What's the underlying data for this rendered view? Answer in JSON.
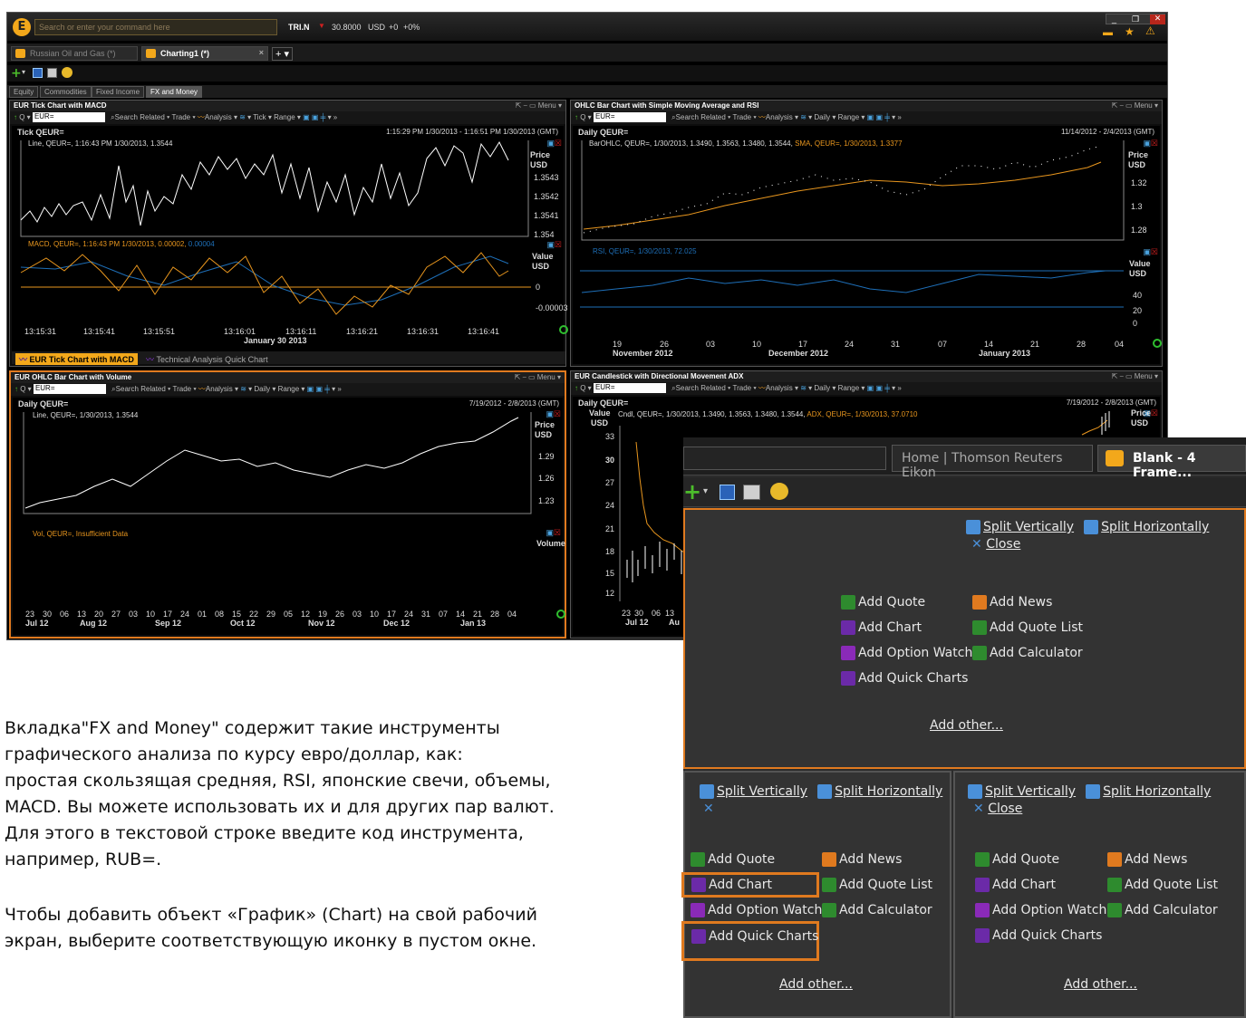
{
  "app": {
    "search_placeholder": "Search or enter your command here",
    "ticker": "TRI.N",
    "price": "30.8000",
    "currency": "USD",
    "change": "+0",
    "change_pct": "+0%"
  },
  "workspace_tabs": [
    {
      "label": "Russian Oil and Gas (*)"
    },
    {
      "label": "Charting1 (*)"
    }
  ],
  "sub_tabs": [
    "Equity",
    "Commodities",
    "Fixed Income",
    "FX and Money"
  ],
  "panels": {
    "tl": {
      "title": "EUR Tick Chart with MACD",
      "ric": "EUR=",
      "chart_label": "Tick QEUR=",
      "range": "1:15:29 PM 1/30/2013 - 1:16:51 PM 1/30/2013 (GMT)",
      "legend1": "Line, QEUR=, 1:16:43 PM 1/30/2013, 1.3544",
      "legend2": "MACD, QEUR=, 1:16:43 PM 1/30/2013, 0.00002,",
      "legend2b": "0.00004",
      "axis_price": "Price",
      "axis_usd": "USD",
      "ticks_price": [
        "1.3543",
        "1.3542",
        "1.3541",
        "1.354"
      ],
      "axis_value": "Value",
      "ticks_value": [
        "0",
        "-0.00003"
      ],
      "times": [
        "13:15:31",
        "13:15:41",
        "13:15:51",
        "13:16:01",
        "13:16:11",
        "13:16:21",
        "13:16:31",
        "13:16:41"
      ],
      "date": "January 30 2013",
      "tab1": "EUR Tick Chart with MACD",
      "tab2": "Technical Analysis Quick Chart"
    },
    "tr": {
      "title": "OHLC Bar Chart with Simple Moving Average and RSI",
      "ric": "EUR=",
      "chart_label": "Daily QEUR=",
      "range": "11/14/2012 - 2/4/2013 (GMT)",
      "legend1": "BarOHLC, QEUR=, 1/30/2013, 1.3490, 1.3563, 1.3480, 1.3544,",
      "legend1b": "SMA, QEUR=, 1/30/2013, 1.3377",
      "legend2": "RSI, QEUR=, 1/30/2013, 72.025",
      "ticks_price": [
        "1.32",
        "1.3",
        "1.28"
      ],
      "ticks_value": [
        "40",
        "20",
        "0"
      ],
      "days": [
        "19",
        "26",
        "03",
        "10",
        "17",
        "24",
        "31",
        "07",
        "14",
        "21",
        "28",
        "04"
      ],
      "months": [
        "November 2012",
        "December 2012",
        "January 2013"
      ]
    },
    "bl": {
      "title": "EUR OHLC Bar Chart with Volume",
      "ric": "EUR=",
      "chart_label": "Daily QEUR=",
      "range": "7/19/2012 - 2/8/2013 (GMT)",
      "legend1": "Line, QEUR=, 1/30/2013, 1.3544",
      "legend2": "Vol, QEUR=, Insufficient Data",
      "ticks_price": [
        "1.29",
        "1.26",
        "1.23"
      ],
      "axis_volume": "Volume",
      "days": [
        "23",
        "30",
        "06",
        "13",
        "20",
        "27",
        "03",
        "10",
        "17",
        "24",
        "01",
        "08",
        "15",
        "22",
        "29",
        "05",
        "12",
        "19",
        "26",
        "03",
        "10",
        "17",
        "24",
        "31",
        "07",
        "14",
        "21",
        "28",
        "04"
      ],
      "months": [
        "Jul 12",
        "Aug 12",
        "Sep 12",
        "Oct 12",
        "Nov 12",
        "Dec 12",
        "Jan 13"
      ]
    },
    "br": {
      "title": "EUR Candlestick with Directional Movement ADX",
      "ric": "EUR=",
      "chart_label": "Daily QEUR=",
      "range": "7/19/2012 - 2/8/2013 (GMT)",
      "legend1": "Cndl, QEUR=, 1/30/2013, 1.3490, 1.3563, 1.3480, 1.3544,",
      "legend1b": "ADX, QEUR=, 1/30/2013, 37.0710",
      "ticks": [
        "33",
        "30",
        "27",
        "24",
        "21",
        "18",
        "15",
        "12"
      ],
      "days": [
        "23",
        "30",
        "06",
        "13"
      ],
      "months": [
        "Jul 12",
        "Au"
      ]
    }
  },
  "toolbar": {
    "search": "Search",
    "related": "Related",
    "trade": "Trade",
    "analysis": "Analysis",
    "tick": "Tick",
    "daily": "Daily",
    "range": "Range",
    "menu": "Menu"
  },
  "overlay": {
    "home_tab": "Home | Thomson Reuters Eikon",
    "blank_tab": "Blank - 4 Frame...",
    "split_v": "Split Vertically",
    "split_h": "Split Horizontally",
    "close": "Close",
    "add_quote": "Add Quote",
    "add_news": "Add News",
    "add_chart": "Add Chart",
    "add_quote_list": "Add Quote List",
    "add_option_watch": "Add Option Watch",
    "add_calculator": "Add Calculator",
    "add_quick_charts": "Add Quick Charts",
    "add_other": "Add other..."
  },
  "text": {
    "p1": [
      "Вкладка\"FX and Money\" содержит такие  инструменты",
      "графического анализа  по курсу евро/доллар,  как:",
      "простая скользящая средняя, RSI, японские свечи, объемы,",
      "MACD. Вы можете использовать их и для других пар валют.",
      "Для этого в текстовой строке введите код инструмента,",
      "например, RUB=."
    ],
    "p2": [
      "Чтобы добавить объект «График» (Chart) на свой рабочий",
      "экран, выберите соответствующую иконку в пустом окне."
    ]
  },
  "colors": {
    "accent": "#e07a1f",
    "brand": "#f3a81b",
    "line": "#ffffff",
    "indicator": "#e8961e",
    "indicator2": "#1e6fb8"
  }
}
